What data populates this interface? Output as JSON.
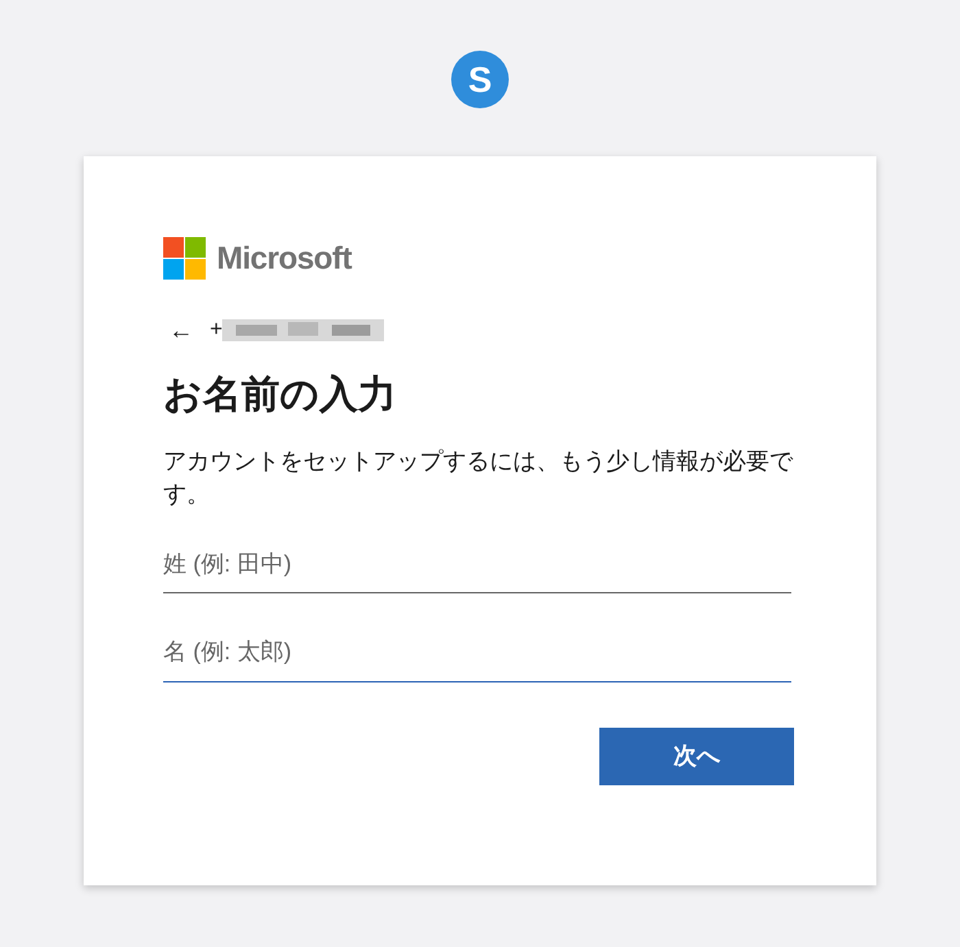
{
  "app_logo": {
    "letter": "S"
  },
  "brand": {
    "name": "Microsoft"
  },
  "account": {
    "back_arrow": "←",
    "identifier": "+"
  },
  "title": "お名前の入力",
  "description": "アカウントをセットアップするには、もう少し情報が必要です。",
  "fields": [
    {
      "placeholder": "姓 (例: 田中)",
      "focused": false
    },
    {
      "placeholder": "名 (例: 太郎)",
      "focused": true
    }
  ],
  "next_button": "次へ"
}
